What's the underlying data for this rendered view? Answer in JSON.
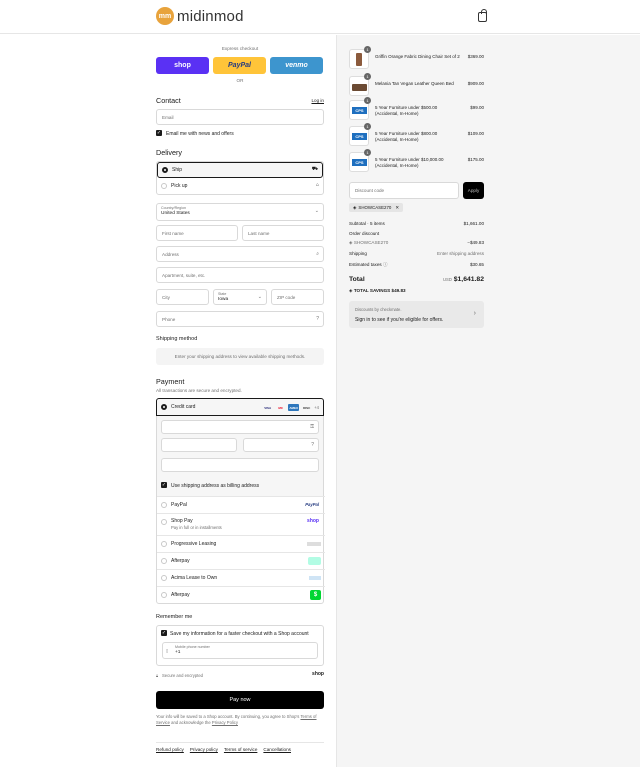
{
  "brand": {
    "name": "midinmod",
    "mark": "mm"
  },
  "express": {
    "label": "Express checkout",
    "shop": "shop",
    "paypal": "PayPal",
    "venmo": "venmo",
    "or": "OR"
  },
  "contact": {
    "title": "Contact",
    "login": "Log in",
    "email_placeholder": "Email",
    "news_label": "Email me with news and offers"
  },
  "delivery": {
    "title": "Delivery",
    "ship_label": "Ship",
    "pickup_label": "Pick up",
    "country_label": "Country/Region",
    "country_value": "United States",
    "first_name": "First name",
    "last_name": "Last name",
    "address": "Address",
    "apartment": "Apartment, suite, etc.",
    "city": "City",
    "state_label": "State",
    "state_value": "Iowa",
    "zip": "ZIP code",
    "phone": "Phone"
  },
  "shipping_method": {
    "title": "Shipping method",
    "note": "Enter your shipping address to view available shipping methods."
  },
  "payment": {
    "title": "Payment",
    "subtitle": "All transactions are secure and encrypted.",
    "credit_card": "Credit card",
    "card_brands": [
      "VISA",
      "MC",
      "AMEX",
      "DISC"
    ],
    "more_brands": "+4",
    "billing_same": "Use shipping address as billing address",
    "methods": [
      {
        "label": "PayPal",
        "logo": "PayPal"
      },
      {
        "label": "Shop Pay",
        "sub": "Pay in full or in installments",
        "logo": "shop"
      },
      {
        "label": "Progressive Leasing",
        "logo": ""
      },
      {
        "label": "Afterpay",
        "logo": ""
      },
      {
        "label": "Acima Lease to Own",
        "logo": ""
      },
      {
        "label": "Afterpay",
        "logo": "$"
      }
    ]
  },
  "remember": {
    "title": "Remember me",
    "save_label": "Save my information for a faster checkout with a Shop account",
    "phone_label": "Mobile phone number",
    "phone_value": "+1",
    "secure": "Secure and encrypted",
    "shop_logo": "shop"
  },
  "pay_now": "Pay now",
  "legal": {
    "line1": "Your info will be saved to a Shop account. By continuing, you agree to Shop's",
    "terms": "Terms of Service",
    "and": "and acknowledge the",
    "privacy": "Privacy Policy"
  },
  "footer": [
    "Refund policy",
    "Privacy policy",
    "Terms of service",
    "Cancellations"
  ],
  "cart": {
    "items": [
      {
        "name": "Griffin Orange Fabric Dining Chair Set of 2",
        "price": "$369.00",
        "qty": "1",
        "thumb": "chair"
      },
      {
        "name": "Melania Tan Vegan Leather Queen Bed",
        "price": "$909.00",
        "qty": "1",
        "thumb": "bed"
      },
      {
        "name": "5 Year Furniture under $500.00 (Accidental, In-Home)",
        "price": "$99.00",
        "qty": "1",
        "thumb": "CPS"
      },
      {
        "name": "5 Year Furniture under $800.00 (Accidental, In-Home)",
        "price": "$109.00",
        "qty": "1",
        "thumb": "CPS"
      },
      {
        "name": "5 Year Furniture under $10,000.00 (Accidental, In-Home)",
        "price": "$175.00",
        "qty": "1",
        "thumb": "CPS"
      }
    ],
    "discount_placeholder": "Discount code",
    "apply": "Apply",
    "applied_code": "SHOWCASE270",
    "subtotal_label": "Subtotal · 5 items",
    "subtotal": "$1,661.00",
    "order_discount": "Order discount",
    "discount_code": "SHOWCASE270",
    "discount_value": "−$49.83",
    "shipping_label": "Shipping",
    "shipping_value": "Enter shipping address",
    "taxes_label": "Estimated taxes",
    "taxes_value": "$30.65",
    "total_label": "Total",
    "currency": "USD",
    "total": "$1,641.82",
    "savings_label": "TOTAL SAVINGS",
    "savings_value": "$49.83",
    "offer_by": "Discounts by checkmate.",
    "offer_text": "Sign in to see if you're eligible for offers."
  },
  "colors": {
    "shop": "#5a31f4",
    "paypal": "#ffc439",
    "venmo": "#3d95ce"
  }
}
